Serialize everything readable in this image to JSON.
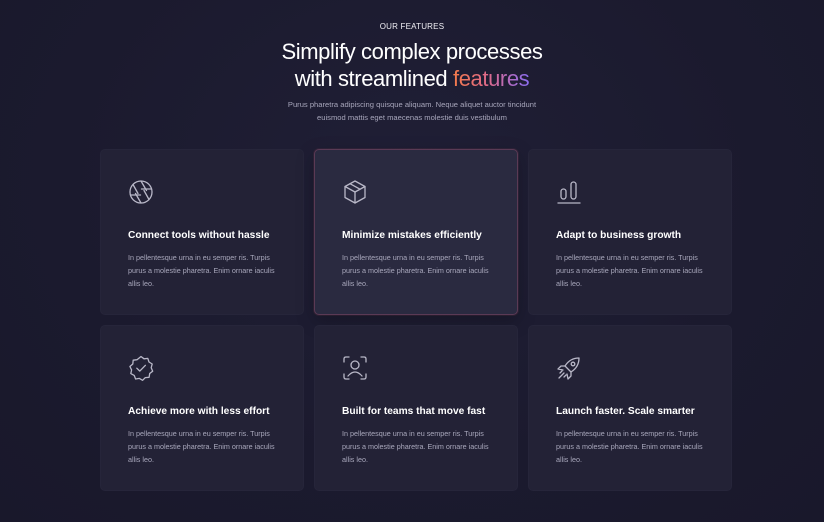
{
  "section": {
    "eyebrow": "OUR FEATURES",
    "headline_line1": "Simplify complex processes",
    "headline_line2_prefix": "with streamlined ",
    "headline_accent": "features",
    "subtitle_line1": "Purus pharetra adipiscing quisque aliquam. Neque aliquet auctor tincidunt",
    "subtitle_line2": "euismod mattis eget maecenas molestie duis vestibulum"
  },
  "colors": {
    "background": "#1b1a2e",
    "card": "#232236",
    "card_active": "#2a2a40",
    "accent_gradient_start": "#f47a4a",
    "accent_gradient_end": "#8a6cf0"
  },
  "features": [
    {
      "icon": "aperture-icon",
      "title": "Connect tools without hassle",
      "desc": "In pellentesque urna in eu semper ris. Turpis purus a molestie pharetra. Enim ornare iaculis allis leo."
    },
    {
      "icon": "cube-icon",
      "title": "Minimize mistakes efficiently",
      "desc": "In pellentesque urna in eu semper ris. Turpis purus a molestie pharetra. Enim ornare iaculis allis leo.",
      "active": true
    },
    {
      "icon": "bar-chart-icon",
      "title": "Adapt to business growth",
      "desc": "In pellentesque urna in eu semper ris. Turpis purus a molestie pharetra. Enim ornare iaculis allis leo."
    },
    {
      "icon": "verified-badge-icon",
      "title": "Achieve more with less effort",
      "desc": "In pellentesque urna in eu semper ris. Turpis purus a molestie pharetra. Enim ornare iaculis allis leo."
    },
    {
      "icon": "user-focus-icon",
      "title": "Built for teams that move fast",
      "desc": "In pellentesque urna in eu semper ris. Turpis purus a molestie pharetra. Enim ornare iaculis allis leo."
    },
    {
      "icon": "rocket-icon",
      "title": "Launch faster. Scale smarter",
      "desc": "In pellentesque urna in eu semper ris. Turpis purus a molestie pharetra. Enim ornare iaculis allis leo."
    }
  ]
}
